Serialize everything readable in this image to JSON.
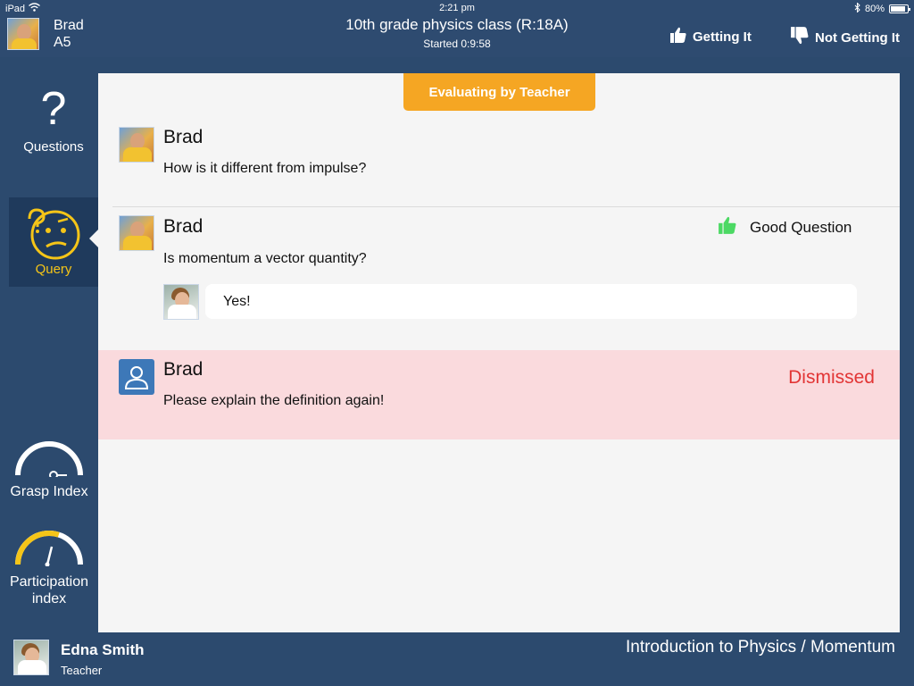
{
  "status_bar": {
    "device": "iPad",
    "time": "2:21 pm",
    "battery": "80%",
    "battery_level": 0.8
  },
  "header": {
    "student_name": "Brad",
    "student_seat": "A5",
    "class_title": "10th grade physics class (R:18A)",
    "started": "Started 0:9:58",
    "getting_it_label": "Getting It",
    "not_getting_it_label": "Not Getting It"
  },
  "sidebar": {
    "questions_label": "Questions",
    "query_label": "Query",
    "grasp_label": "Grasp Index",
    "participation_label": "Participation index",
    "participation_level": 0.6
  },
  "main": {
    "badge": "Evaluating by Teacher",
    "queries": [
      {
        "name": "Brad",
        "text": "How is it different from impulse?"
      },
      {
        "name": "Brad",
        "text": "Is momentum a vector quantity?",
        "status": "Good Question",
        "reply": "Yes!"
      },
      {
        "name": "Brad",
        "text": "Please explain the definition again!",
        "status": "Dismissed"
      }
    ]
  },
  "footer": {
    "teacher_name": "Edna Smith",
    "teacher_role": "Teacher",
    "topic": "Introduction to Physics / Momentum"
  },
  "colors": {
    "header_bg": "#2e4b70",
    "accent_orange": "#f5a623",
    "active_yellow": "#f5c518",
    "dismissed_red": "#e23535",
    "dismissed_bg": "#fadadd",
    "good_green": "#4cd964"
  }
}
